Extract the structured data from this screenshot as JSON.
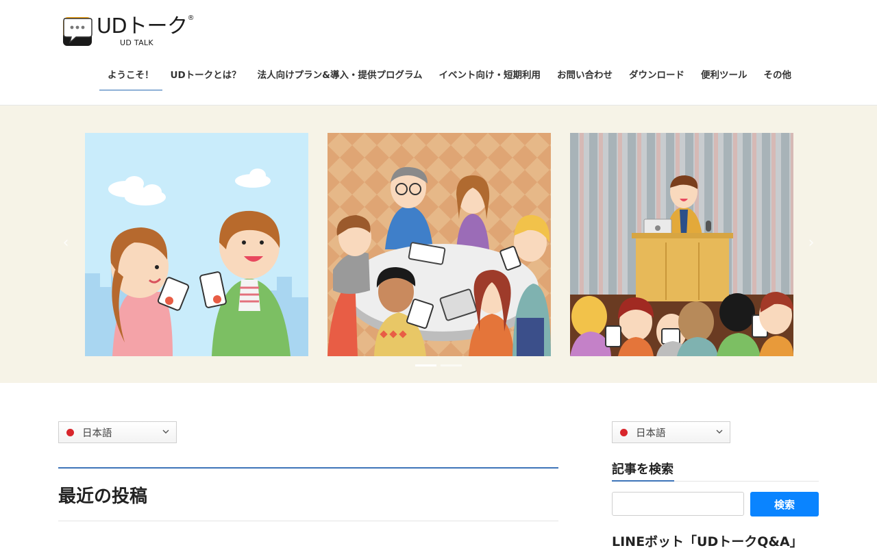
{
  "logo": {
    "title": "UDトーク",
    "registered": "®",
    "subtitle": "UD TALK"
  },
  "nav": {
    "items": [
      {
        "label": "ようこそ！",
        "active": true
      },
      {
        "label": "UDトークとは？",
        "active": false
      },
      {
        "label": "法人向けプラン&導入・提供プログラム",
        "active": false
      },
      {
        "label": "イベント向け・短期利用",
        "active": false
      },
      {
        "label": "お問い合わせ",
        "active": false
      },
      {
        "label": "ダウンロード",
        "active": false
      },
      {
        "label": "便利ツール",
        "active": false
      },
      {
        "label": "その他",
        "active": false
      }
    ]
  },
  "carousel": {
    "prev_icon": "chevron-left-icon",
    "next_icon": "chevron-right-icon",
    "prev_glyph": "‹",
    "next_glyph": "›",
    "active_index": 0,
    "dot_count": 2
  },
  "main": {
    "language": {
      "label": "日本語"
    },
    "title": "最近の投稿"
  },
  "sidebar": {
    "language": {
      "label": "日本語"
    },
    "search_title": "記事を検索",
    "search_placeholder": "",
    "search_button": "検索",
    "line_bot_title": "LINEボット「UDトークQ&A」"
  },
  "colors": {
    "accent_blue": "#3d74b8",
    "button_blue": "#0a84ff",
    "hero_bg": "#f6f3e7",
    "flag_red": "#d8262c"
  }
}
